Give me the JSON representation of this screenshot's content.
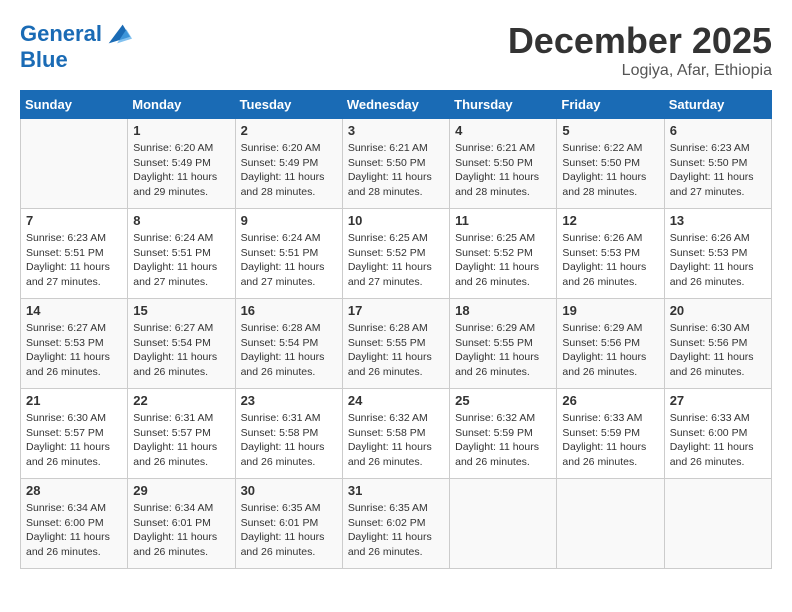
{
  "logo": {
    "line1": "General",
    "line2": "Blue"
  },
  "title": "December 2025",
  "location": "Logiya, Afar, Ethiopia",
  "weekdays": [
    "Sunday",
    "Monday",
    "Tuesday",
    "Wednesday",
    "Thursday",
    "Friday",
    "Saturday"
  ],
  "weeks": [
    [
      {
        "day": "",
        "sunrise": "",
        "sunset": "",
        "daylight": ""
      },
      {
        "day": "1",
        "sunrise": "Sunrise: 6:20 AM",
        "sunset": "Sunset: 5:49 PM",
        "daylight": "Daylight: 11 hours and 29 minutes."
      },
      {
        "day": "2",
        "sunrise": "Sunrise: 6:20 AM",
        "sunset": "Sunset: 5:49 PM",
        "daylight": "Daylight: 11 hours and 28 minutes."
      },
      {
        "day": "3",
        "sunrise": "Sunrise: 6:21 AM",
        "sunset": "Sunset: 5:50 PM",
        "daylight": "Daylight: 11 hours and 28 minutes."
      },
      {
        "day": "4",
        "sunrise": "Sunrise: 6:21 AM",
        "sunset": "Sunset: 5:50 PM",
        "daylight": "Daylight: 11 hours and 28 minutes."
      },
      {
        "day": "5",
        "sunrise": "Sunrise: 6:22 AM",
        "sunset": "Sunset: 5:50 PM",
        "daylight": "Daylight: 11 hours and 28 minutes."
      },
      {
        "day": "6",
        "sunrise": "Sunrise: 6:23 AM",
        "sunset": "Sunset: 5:50 PM",
        "daylight": "Daylight: 11 hours and 27 minutes."
      }
    ],
    [
      {
        "day": "7",
        "sunrise": "Sunrise: 6:23 AM",
        "sunset": "Sunset: 5:51 PM",
        "daylight": "Daylight: 11 hours and 27 minutes."
      },
      {
        "day": "8",
        "sunrise": "Sunrise: 6:24 AM",
        "sunset": "Sunset: 5:51 PM",
        "daylight": "Daylight: 11 hours and 27 minutes."
      },
      {
        "day": "9",
        "sunrise": "Sunrise: 6:24 AM",
        "sunset": "Sunset: 5:51 PM",
        "daylight": "Daylight: 11 hours and 27 minutes."
      },
      {
        "day": "10",
        "sunrise": "Sunrise: 6:25 AM",
        "sunset": "Sunset: 5:52 PM",
        "daylight": "Daylight: 11 hours and 27 minutes."
      },
      {
        "day": "11",
        "sunrise": "Sunrise: 6:25 AM",
        "sunset": "Sunset: 5:52 PM",
        "daylight": "Daylight: 11 hours and 26 minutes."
      },
      {
        "day": "12",
        "sunrise": "Sunrise: 6:26 AM",
        "sunset": "Sunset: 5:53 PM",
        "daylight": "Daylight: 11 hours and 26 minutes."
      },
      {
        "day": "13",
        "sunrise": "Sunrise: 6:26 AM",
        "sunset": "Sunset: 5:53 PM",
        "daylight": "Daylight: 11 hours and 26 minutes."
      }
    ],
    [
      {
        "day": "14",
        "sunrise": "Sunrise: 6:27 AM",
        "sunset": "Sunset: 5:53 PM",
        "daylight": "Daylight: 11 hours and 26 minutes."
      },
      {
        "day": "15",
        "sunrise": "Sunrise: 6:27 AM",
        "sunset": "Sunset: 5:54 PM",
        "daylight": "Daylight: 11 hours and 26 minutes."
      },
      {
        "day": "16",
        "sunrise": "Sunrise: 6:28 AM",
        "sunset": "Sunset: 5:54 PM",
        "daylight": "Daylight: 11 hours and 26 minutes."
      },
      {
        "day": "17",
        "sunrise": "Sunrise: 6:28 AM",
        "sunset": "Sunset: 5:55 PM",
        "daylight": "Daylight: 11 hours and 26 minutes."
      },
      {
        "day": "18",
        "sunrise": "Sunrise: 6:29 AM",
        "sunset": "Sunset: 5:55 PM",
        "daylight": "Daylight: 11 hours and 26 minutes."
      },
      {
        "day": "19",
        "sunrise": "Sunrise: 6:29 AM",
        "sunset": "Sunset: 5:56 PM",
        "daylight": "Daylight: 11 hours and 26 minutes."
      },
      {
        "day": "20",
        "sunrise": "Sunrise: 6:30 AM",
        "sunset": "Sunset: 5:56 PM",
        "daylight": "Daylight: 11 hours and 26 minutes."
      }
    ],
    [
      {
        "day": "21",
        "sunrise": "Sunrise: 6:30 AM",
        "sunset": "Sunset: 5:57 PM",
        "daylight": "Daylight: 11 hours and 26 minutes."
      },
      {
        "day": "22",
        "sunrise": "Sunrise: 6:31 AM",
        "sunset": "Sunset: 5:57 PM",
        "daylight": "Daylight: 11 hours and 26 minutes."
      },
      {
        "day": "23",
        "sunrise": "Sunrise: 6:31 AM",
        "sunset": "Sunset: 5:58 PM",
        "daylight": "Daylight: 11 hours and 26 minutes."
      },
      {
        "day": "24",
        "sunrise": "Sunrise: 6:32 AM",
        "sunset": "Sunset: 5:58 PM",
        "daylight": "Daylight: 11 hours and 26 minutes."
      },
      {
        "day": "25",
        "sunrise": "Sunrise: 6:32 AM",
        "sunset": "Sunset: 5:59 PM",
        "daylight": "Daylight: 11 hours and 26 minutes."
      },
      {
        "day": "26",
        "sunrise": "Sunrise: 6:33 AM",
        "sunset": "Sunset: 5:59 PM",
        "daylight": "Daylight: 11 hours and 26 minutes."
      },
      {
        "day": "27",
        "sunrise": "Sunrise: 6:33 AM",
        "sunset": "Sunset: 6:00 PM",
        "daylight": "Daylight: 11 hours and 26 minutes."
      }
    ],
    [
      {
        "day": "28",
        "sunrise": "Sunrise: 6:34 AM",
        "sunset": "Sunset: 6:00 PM",
        "daylight": "Daylight: 11 hours and 26 minutes."
      },
      {
        "day": "29",
        "sunrise": "Sunrise: 6:34 AM",
        "sunset": "Sunset: 6:01 PM",
        "daylight": "Daylight: 11 hours and 26 minutes."
      },
      {
        "day": "30",
        "sunrise": "Sunrise: 6:35 AM",
        "sunset": "Sunset: 6:01 PM",
        "daylight": "Daylight: 11 hours and 26 minutes."
      },
      {
        "day": "31",
        "sunrise": "Sunrise: 6:35 AM",
        "sunset": "Sunset: 6:02 PM",
        "daylight": "Daylight: 11 hours and 26 minutes."
      },
      {
        "day": "",
        "sunrise": "",
        "sunset": "",
        "daylight": ""
      },
      {
        "day": "",
        "sunrise": "",
        "sunset": "",
        "daylight": ""
      },
      {
        "day": "",
        "sunrise": "",
        "sunset": "",
        "daylight": ""
      }
    ]
  ]
}
